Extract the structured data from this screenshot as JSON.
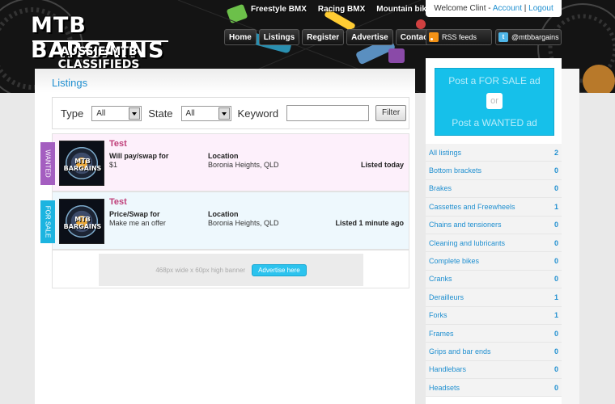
{
  "brand": {
    "title": "MTB BARGAINS",
    "subtitle": "AUSSIE MTB CLASSIFIEDS"
  },
  "top_links": [
    "Freestyle BMX",
    "Racing BMX",
    "Mountain bikes"
  ],
  "main_nav": [
    "Home",
    "Listings",
    "Register",
    "Advertise",
    "Contact"
  ],
  "welcome": {
    "text": "Welcome Clint - ",
    "account": "Account",
    "sep": " | ",
    "logout": "Logout"
  },
  "social": {
    "rss": "RSS feeds",
    "twitter": "@mtbbargains"
  },
  "page_title": "Listings",
  "filter": {
    "type_label": "Type",
    "type_value": "All",
    "state_label": "State",
    "state_value": "All",
    "keyword_label": "Keyword",
    "keyword_value": "",
    "button": "Filter"
  },
  "listings": [
    {
      "tag": "WANTED",
      "title": "Test",
      "price_label": "Will pay/swap for",
      "price": "$1",
      "location_label": "Location",
      "location": "Boronia Heights, QLD",
      "time": "Listed today",
      "thumb_text": "MTB BARGAINS"
    },
    {
      "tag": "FOR SALE",
      "title": "Test",
      "price_label": "Price/Swap for",
      "price": "Make me an offer",
      "location_label": "Location",
      "location": "Boronia Heights, QLD",
      "time": "Listed 1 minute ago",
      "thumb_text": "MTB BARGAINS"
    }
  ],
  "banner": {
    "text": "468px wide x 60px high banner",
    "button": "Advertise here"
  },
  "post": {
    "sale": "Post a FOR SALE ad",
    "or": "or",
    "wanted": "Post a WANTED ad"
  },
  "categories": [
    {
      "name": "All listings",
      "count": "2"
    },
    {
      "name": "Bottom brackets",
      "count": "0"
    },
    {
      "name": "Brakes",
      "count": "0"
    },
    {
      "name": "Cassettes and Freewheels",
      "count": "1"
    },
    {
      "name": "Chains and tensioners",
      "count": "0"
    },
    {
      "name": "Cleaning and lubricants",
      "count": "0"
    },
    {
      "name": "Complete bikes",
      "count": "0"
    },
    {
      "name": "Cranks",
      "count": "0"
    },
    {
      "name": "Derailleurs",
      "count": "1"
    },
    {
      "name": "Forks",
      "count": "1"
    },
    {
      "name": "Frames",
      "count": "0"
    },
    {
      "name": "Grips and bar ends",
      "count": "0"
    },
    {
      "name": "Handlebars",
      "count": "0"
    },
    {
      "name": "Headsets",
      "count": "0"
    }
  ],
  "colors": {
    "accent": "#1f8fd0",
    "wanted": "#a45ec0",
    "for_sale": "#1cb4e0",
    "post_box": "#16c0ea"
  }
}
